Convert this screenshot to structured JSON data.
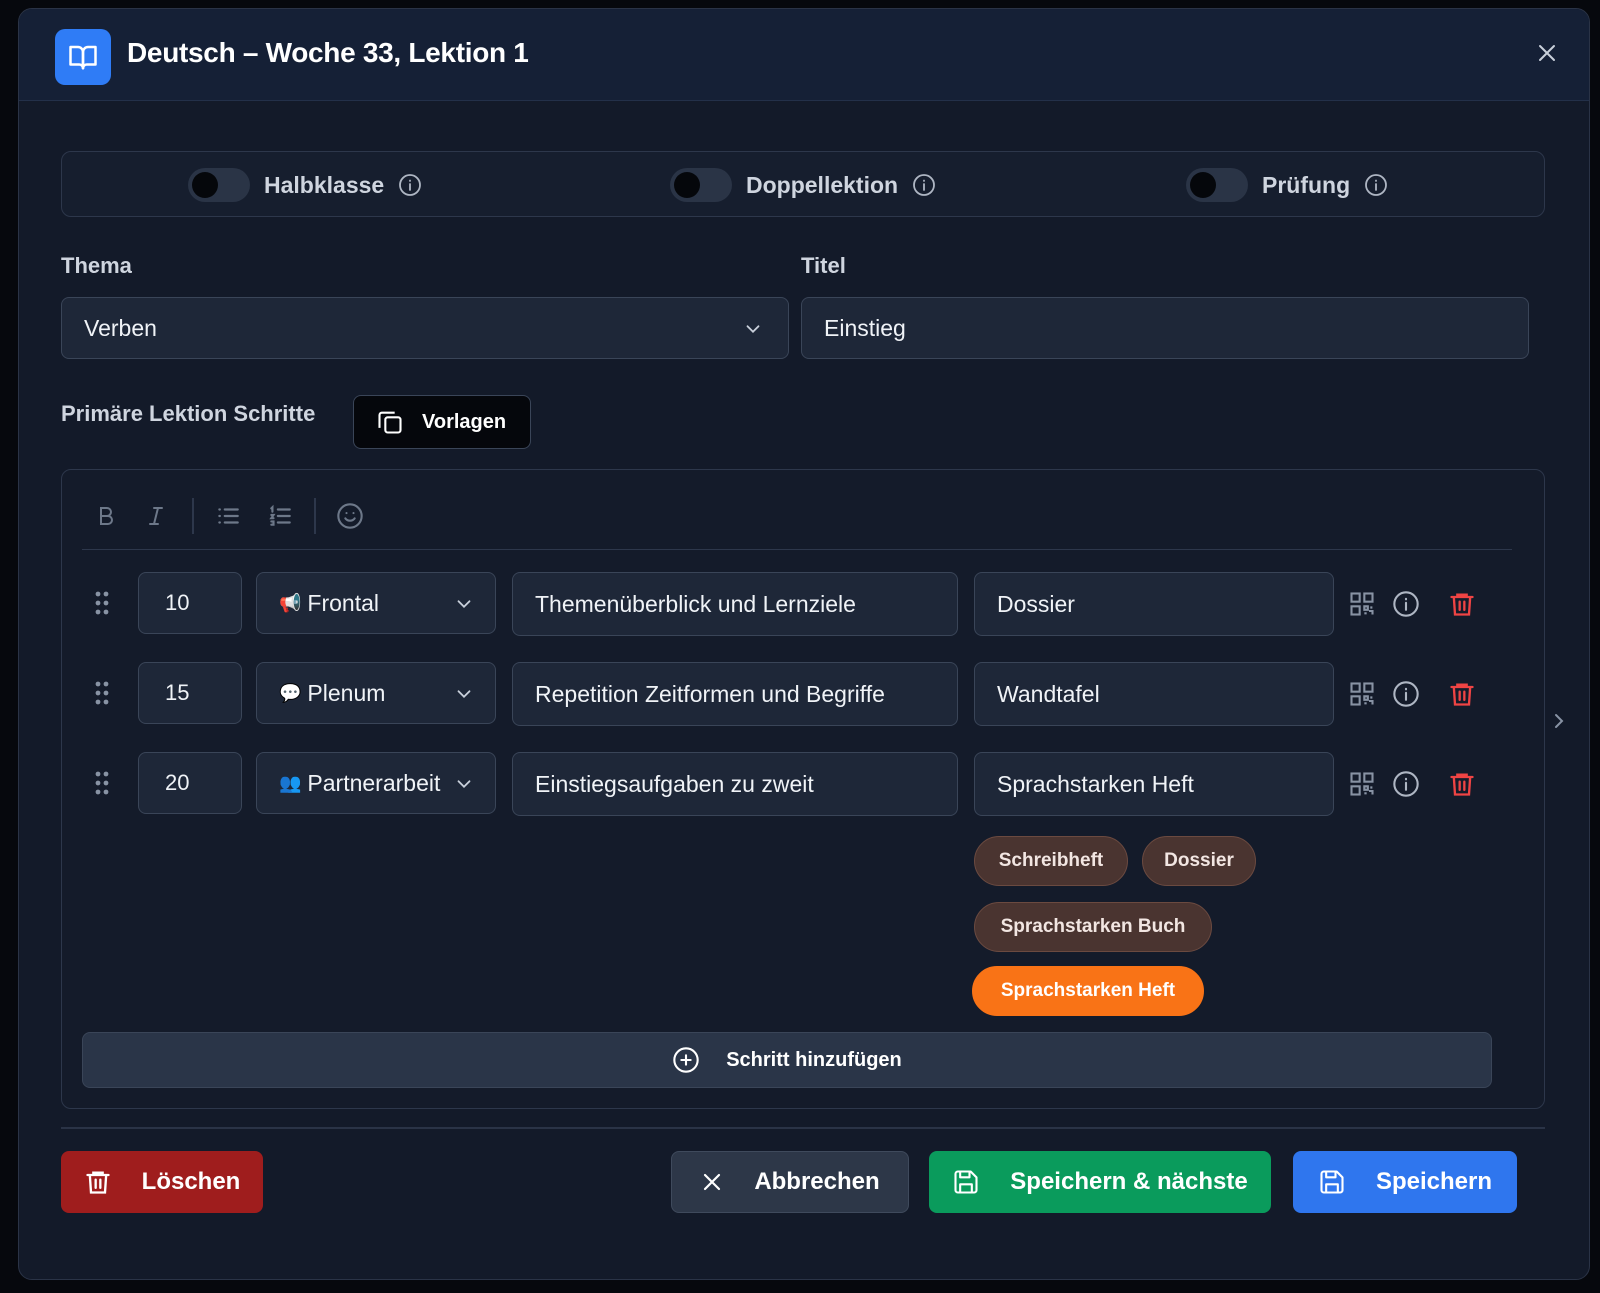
{
  "header": {
    "title": "Deutsch – Woche 33, Lektion 1",
    "icon": "book-icon"
  },
  "toggles": [
    {
      "label": "Halbklasse",
      "on": false
    },
    {
      "label": "Doppellektion",
      "on": false
    },
    {
      "label": "Prüfung",
      "on": false
    }
  ],
  "form": {
    "thema_label": "Thema",
    "thema_value": "Verben",
    "titel_label": "Titel",
    "titel_value": "Einstieg"
  },
  "steps_section": {
    "label": "Primäre Lektion Schritte",
    "vorlagen_label": "Vorlagen"
  },
  "steps": [
    {
      "minutes": "10",
      "emoji": "📢",
      "mode": "Frontal",
      "description": "Themenüberblick und Lernziele",
      "material": "Dossier"
    },
    {
      "minutes": "15",
      "emoji": "💬",
      "mode": "Plenum",
      "description": "Repetition Zeitformen und Begriffe",
      "material": "Wandtafel"
    },
    {
      "minutes": "20",
      "emoji": "👥",
      "mode": "Partnerarbeit",
      "description": "Einstiegsaufgaben zu zweit",
      "material": "Sprachstarken Heft"
    }
  ],
  "material_chips": [
    {
      "label": "Schreibheft",
      "active": false
    },
    {
      "label": "Dossier",
      "active": false
    },
    {
      "label": "Sprachstarken Buch",
      "active": false
    },
    {
      "label": "Sprachstarken Heft",
      "active": true
    }
  ],
  "add_step_label": "Schritt hinzufügen",
  "footer": {
    "delete_label": "Löschen",
    "cancel_label": "Abbrechen",
    "save_next_label": "Speichern & nächste",
    "save_label": "Speichern"
  },
  "colors": {
    "accent": "#2f76ee",
    "success": "#0a9b5c",
    "danger": "#9f1d1d",
    "chip_active": "#f97316",
    "trash": "#ef4444"
  }
}
